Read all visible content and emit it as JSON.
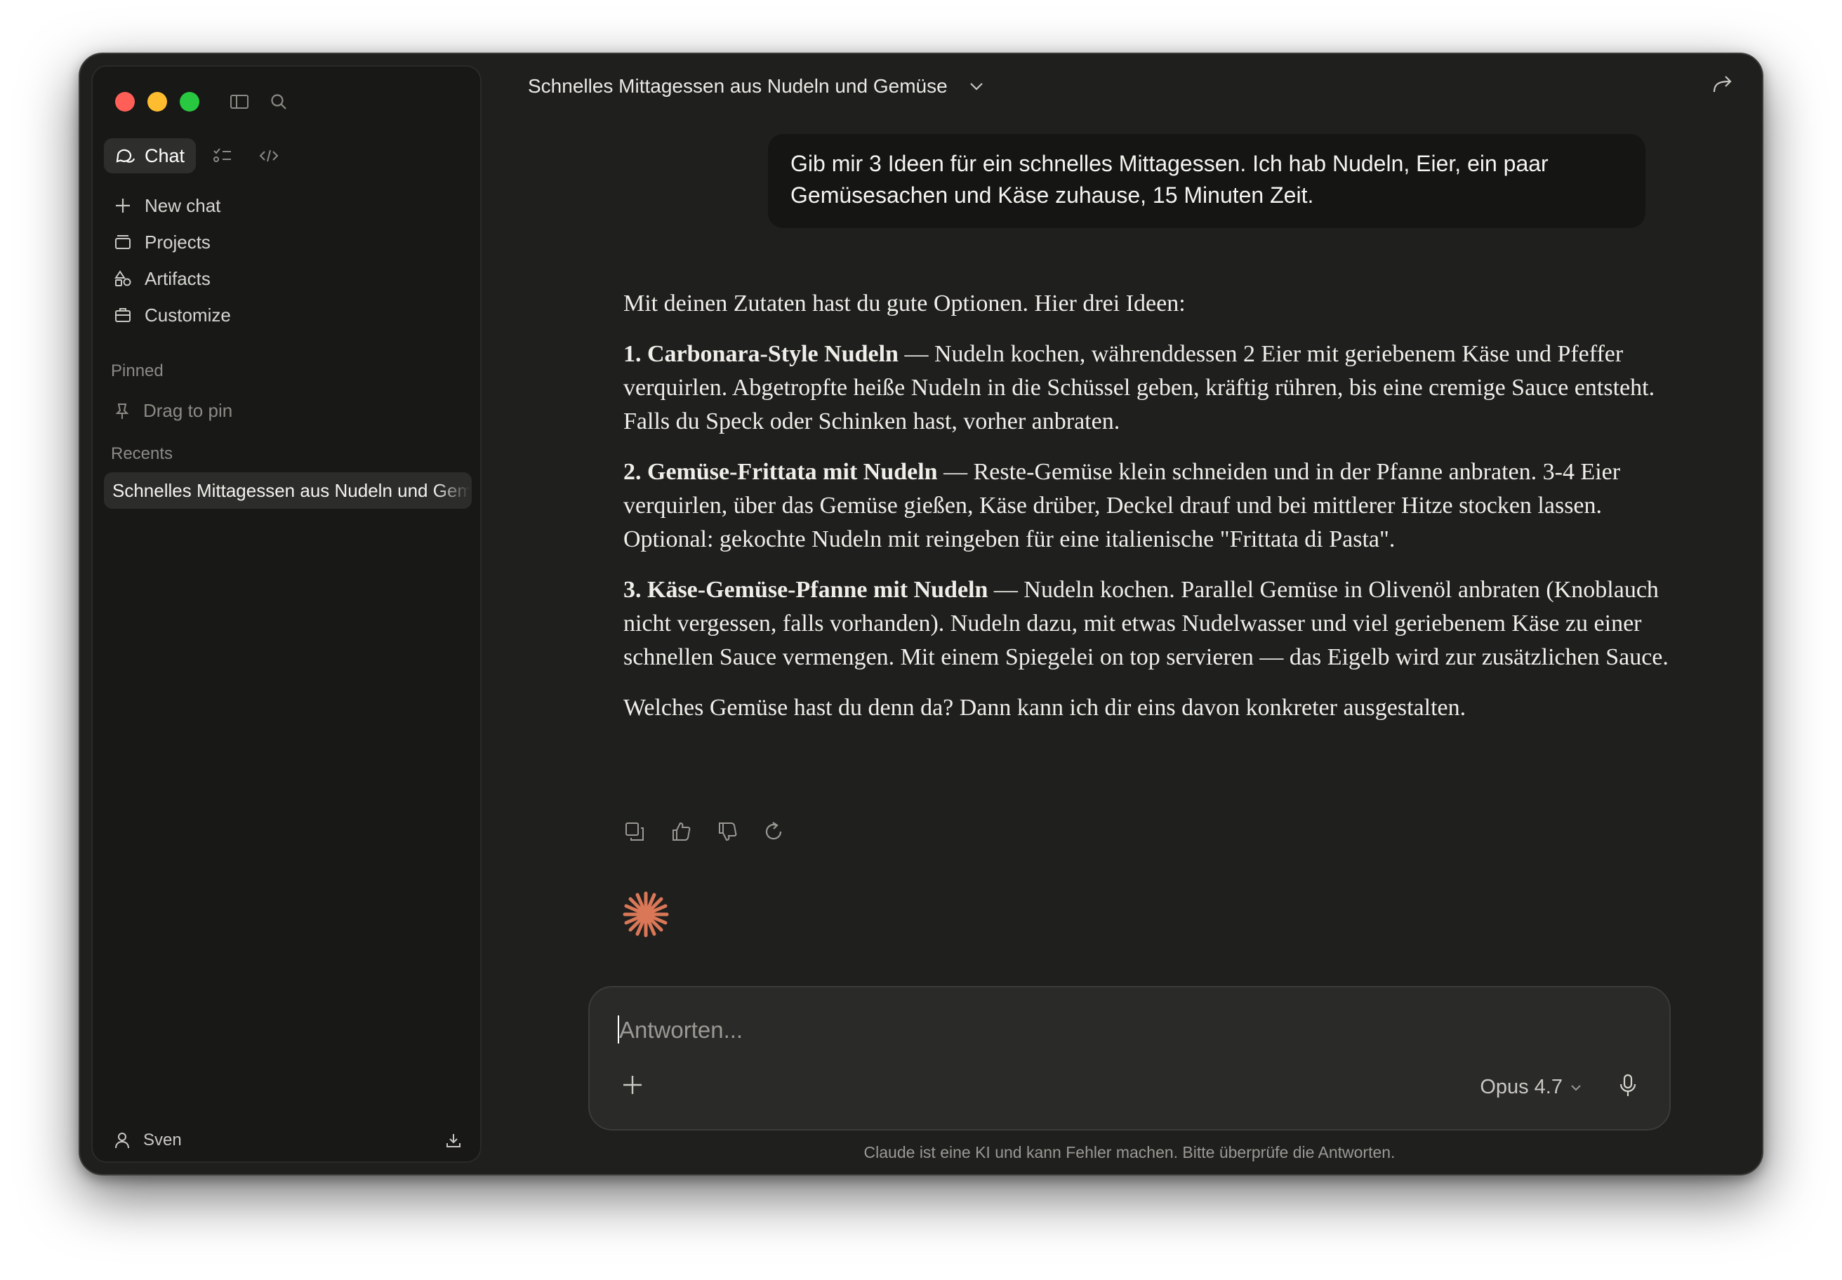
{
  "window": {
    "title": "Schnelles Mittagessen aus Nudeln und Gemüse"
  },
  "sidebar": {
    "mode_chat_label": "Chat",
    "nav": [
      {
        "label": "New chat",
        "icon": "plus-icon"
      },
      {
        "label": "Projects",
        "icon": "folder-icon"
      },
      {
        "label": "Artifacts",
        "icon": "shapes-icon"
      },
      {
        "label": "Customize",
        "icon": "briefcase-icon"
      }
    ],
    "pinned_label": "Pinned",
    "drag_to_pin": "Drag to pin",
    "recents_label": "Recents",
    "recents": [
      "Schnelles Mittagessen aus Nudeln und Gemüse"
    ],
    "user_name": "Sven"
  },
  "conversation": {
    "user_message": "Gib mir 3 Ideen für ein schnelles Mittagessen. Ich hab Nudeln, Eier, ein paar Gemüsesachen und Käse zuhause, 15 Minuten Zeit.",
    "intro": "Mit deinen Zutaten hast du gute Optionen. Hier drei Ideen:",
    "ideas": [
      {
        "title": "1. Carbonara-Style Nudeln",
        "text": " — Nudeln kochen, währenddessen 2 Eier mit geriebenem Käse und Pfeffer verquirlen. Abgetropfte heiße Nudeln in die Schüssel geben, kräftig rühren, bis eine cremige Sauce entsteht. Falls du Speck oder Schinken hast, vorher anbraten."
      },
      {
        "title": "2. Gemüse-Frittata mit Nudeln",
        "text": " — Reste-Gemüse klein schneiden und in der Pfanne anbraten. 3-4 Eier verquirlen, über das Gemüse gießen, Käse drüber, Deckel drauf und bei mittlerer Hitze stocken lassen. Optional: gekochte Nudeln mit reingeben für eine italienische \"Frittata di Pasta\"."
      },
      {
        "title": "3. Käse-Gemüse-Pfanne mit Nudeln",
        "text": " — Nudeln kochen. Parallel Gemüse in Olivenöl anbraten (Knoblauch nicht vergessen, falls vorhanden). Nudeln dazu, mit etwas Nudelwasser und viel geriebenem Käse zu einer schnellen Sauce vermengen. Mit einem Spiegelei on top servieren — das Eigelb wird zur zusätzlichen Sauce."
      }
    ],
    "outro": "Welches Gemüse hast du denn da? Dann kann ich dir eins davon konkreter ausgestalten."
  },
  "composer": {
    "placeholder": "Antworten...",
    "value": "",
    "model": "Opus 4.7"
  },
  "disclaimer": "Claude ist eine KI und kann Fehler machen. Bitte überprüfe die Antworten.",
  "colors": {
    "accent_spark": "#d97757",
    "window_bg": "#1f1f1e",
    "sidebar_bg": "#181817"
  }
}
